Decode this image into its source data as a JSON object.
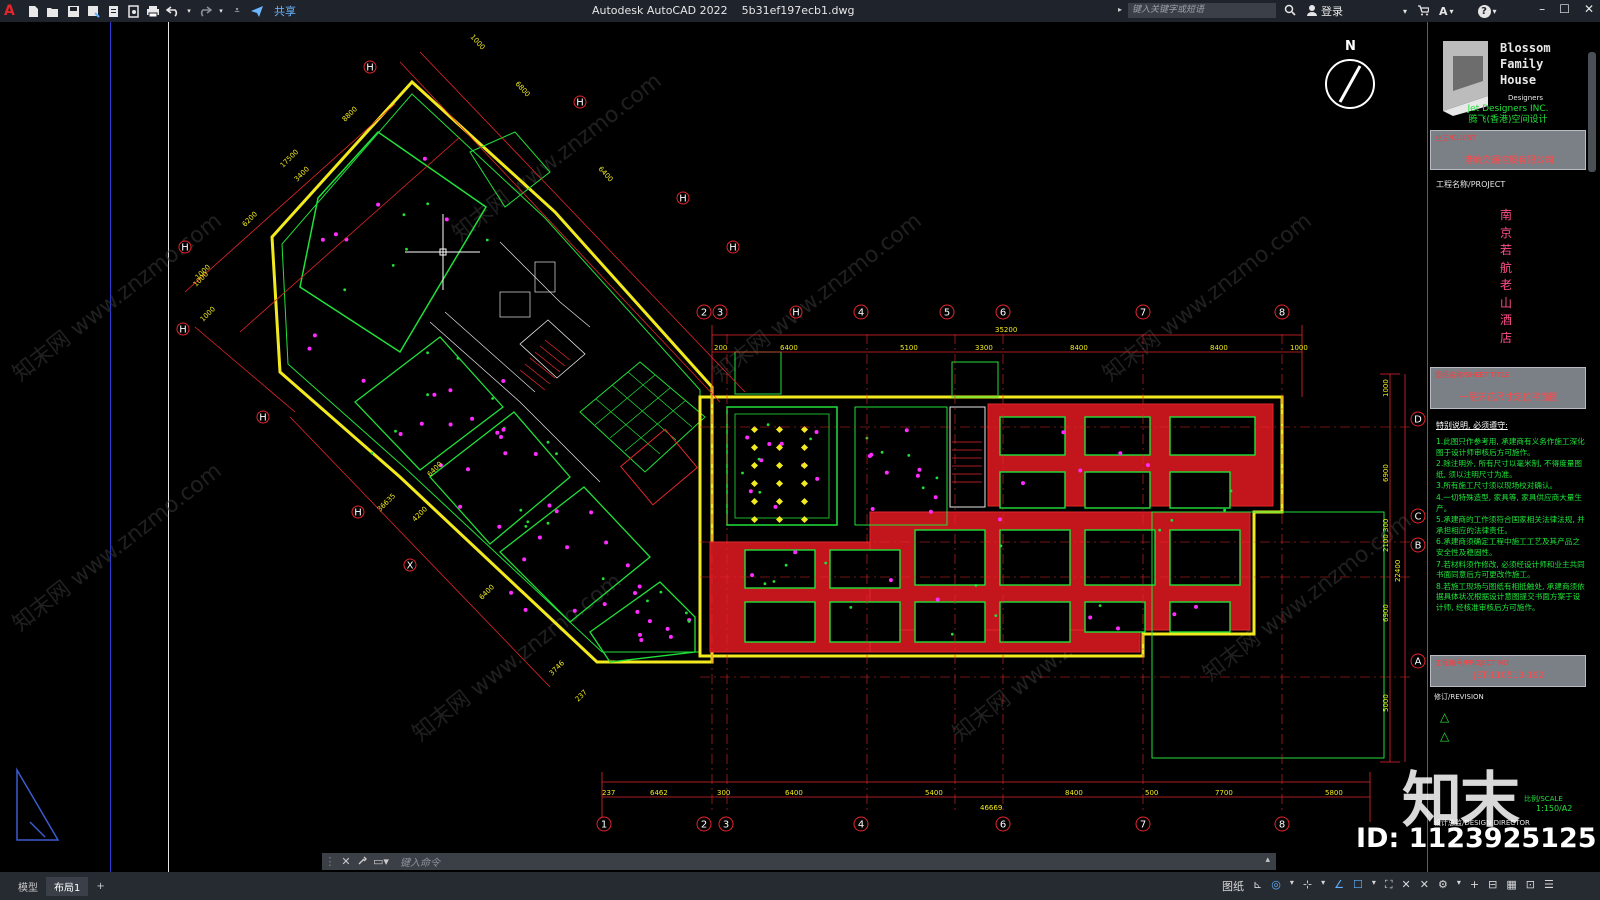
{
  "app": {
    "title": "Autodesk AutoCAD 2022",
    "filename": "5b31ef197ecb1.dwg",
    "logo_letter": "A",
    "share_label": "共享",
    "search_placeholder": "键入关键字或短语",
    "login_label": "登录",
    "help_label": "?"
  },
  "quick_access": [
    "new-icon",
    "open-icon",
    "save-icon",
    "save-as-icon",
    "publish-icon",
    "plot-preview-icon",
    "print-icon",
    "undo-icon",
    "redo-icon",
    "customize-icon"
  ],
  "drawing": {
    "north_label": "N",
    "grid_top": [
      "2",
      "3",
      "4",
      "5",
      "6",
      "7",
      "8"
    ],
    "grid_bottom": [
      "1",
      "2",
      "3",
      "4",
      "6",
      "7",
      "8"
    ],
    "grid_right": [
      "D",
      "C",
      "B",
      "A"
    ],
    "grid_diag": [
      "H",
      "H",
      "H",
      "H",
      "H",
      "H",
      "H",
      "H",
      "H",
      "X"
    ],
    "dims_top": [
      "200",
      "6400",
      "5100",
      "3300",
      "8400",
      "8400",
      "1000"
    ],
    "dim_top_total": "35200",
    "dims_bottom": [
      "237",
      "6462",
      "300",
      "6400",
      "5400",
      "8400",
      "500",
      "7700",
      "5800"
    ],
    "dim_bottom_total": "46669",
    "dims_right": [
      "1000",
      "6900",
      "300",
      "2100",
      "6900",
      "5000"
    ],
    "dim_right_total": "22400",
    "dims_diag": [
      "1000",
      "6800",
      "6400",
      "1000",
      "6200",
      "1000",
      "1000",
      "8800",
      "36635",
      "6400",
      "4200",
      "6400",
      "3746",
      "237",
      "17500",
      "3400"
    ],
    "watermark": "知末网 www.znzmo.com"
  },
  "title_block": {
    "logo_lines": [
      "Blossom",
      "Family",
      "House",
      "Designers"
    ],
    "company_en": "Jet Designers INC.",
    "company_cn": "腾飞(香港)空间设计",
    "client_label": "业主/CLIENT",
    "client_value": "港航交通控股有限公司",
    "project_label": "工程名称/PROJECT",
    "project_chars": [
      "南",
      "京",
      "若",
      "航",
      "老",
      "山",
      "酒",
      "店"
    ],
    "sheet_label": "图纸名称/SHEET TITLE",
    "sheet_value": "一层天花尺寸定位平面图",
    "notes_title": "特别说明, 必须遵守:",
    "notes": [
      "1.此图只作参考用, 承建商有义务作施工深化图于设计师审核后方可施作。",
      "2.除注明外, 所有尺寸以毫米制, 不得度量图纸, 须以注明尺寸为准。",
      "3.所有施工尺寸须以现场校对确认。",
      "4.一切特殊造型, 家具等, 家具供应商大量生产。",
      "5.承建商的工作须符合国家相关法律法规, 并承担相应的法律责任。",
      "6.承建商须确定工程中施工工艺及其产品之安全性及稳固性。",
      "7.若材料须作修改, 必须经设计师和业主共同书面同意后方可更改作施工。",
      "8.若施工现场与图纸有相抵触处, 承建商须依据具体状况根据设计意图提交书面方案于设计师, 经核准审核后方可施作。"
    ],
    "project_no_label": "工程编号/PROJECT NO",
    "project_no": "JET-110513-192",
    "revision_label": "修订/REVISION",
    "scale_label": "比例/SCALE",
    "scale_value": "1:150/A2",
    "director_label": "设计总监/DESIGN DIRECTOR"
  },
  "overlays": {
    "logo_text": "知末",
    "id_text": "ID: 1123925125"
  },
  "command_line": {
    "placeholder": "键入命令"
  },
  "status_bar": {
    "tabs": [
      "模型",
      "布局1"
    ],
    "active_tab": "布局1",
    "add_tab": "+",
    "paper_label": "图纸"
  },
  "colors": {
    "titlebar": "#1f232b",
    "green": "#21e03a",
    "yellow": "#f2ea1f",
    "red": "#e3262b",
    "magenta": "#ff2bff",
    "blue_line": "#3b5bd0"
  }
}
